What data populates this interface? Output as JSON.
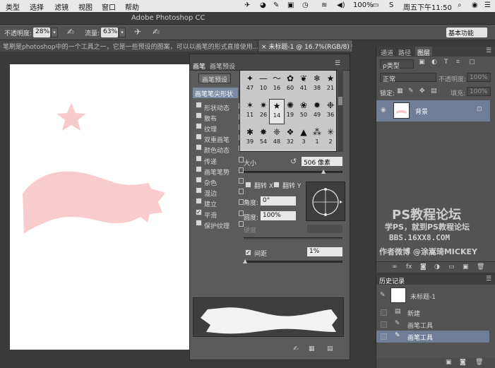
{
  "menubar": {
    "items": [
      "类型",
      "选择",
      "滤镜",
      "视图",
      "窗口",
      "帮助"
    ],
    "battery": "100%",
    "clock": "周五下午11:50"
  },
  "app": {
    "title": "Adobe Photoshop CC"
  },
  "options": {
    "opacity_label": "不透明度:",
    "opacity_value": "28%",
    "flow_label": "流量:",
    "flow_value": "63%",
    "workspace": "基本功能"
  },
  "tabs": [
    {
      "label": "笔刷是photoshop中的一个工具之一，它是一些预设的图案，可以以画笔的形式直接使用..."
    },
    {
      "label": "未标题-1 @ 16.7%(RGB/8) *"
    }
  ],
  "brush_panel": {
    "tab_brush": "画笔",
    "tab_presets": "画笔预设",
    "presets_button": "画笔预设",
    "tip_shape": "画笔笔尖形状",
    "sections": [
      {
        "label": "形状动态",
        "checked": false
      },
      {
        "label": "散布",
        "checked": false
      },
      {
        "label": "纹理",
        "checked": false
      },
      {
        "label": "双重画笔",
        "checked": false
      },
      {
        "label": "颜色动态",
        "checked": false
      },
      {
        "label": "传递",
        "checked": false
      },
      {
        "label": "画笔笔势",
        "checked": false
      },
      {
        "label": "杂色",
        "checked": false
      },
      {
        "label": "湿边",
        "checked": false
      },
      {
        "label": "建立",
        "checked": false
      },
      {
        "label": "平滑",
        "checked": true
      },
      {
        "label": "保护纹理",
        "checked": false
      }
    ],
    "tip_sizes": [
      "47",
      "10",
      "16",
      "60",
      "41",
      "38",
      "21",
      "11",
      "26",
      "14",
      "19",
      "50",
      "49",
      "36",
      "39",
      "54",
      "48",
      "32",
      "3",
      "1",
      "2"
    ],
    "size_label": "大小",
    "size_value": "506 像素",
    "flip_x": "翻转 X",
    "flip_y": "翻转 Y",
    "angle_label": "角度:",
    "angle_value": "0°",
    "roundness_label": "圆度:",
    "roundness_value": "100%",
    "hardness_label": "硬度",
    "spacing_label": "间距",
    "spacing_value": "1%"
  },
  "layers_panel": {
    "tabs": [
      "通道",
      "路径",
      "图层"
    ],
    "kind_filter": "ρ类型",
    "blend_mode": "正常",
    "opacity_label": "不透明度:",
    "opacity_value": "100%",
    "lock_label": "锁定:",
    "fill_label": "填充:",
    "fill_value": "100%",
    "layer_name": "背景"
  },
  "watermark": {
    "line1": "PS教程论坛",
    "line2": "学PS，就到PS教程论坛",
    "line3": "BBS.16XX8.COM",
    "line4": "作者微博 @涂嵩琦MICKEY"
  },
  "history_panel": {
    "title": "历史记录",
    "snapshot": "未标题-1",
    "items": [
      "新建",
      "画笔工具",
      "画笔工具"
    ]
  },
  "colors": {
    "accent": "#6f7d96",
    "canvas_shape": "#f7c6c6"
  }
}
